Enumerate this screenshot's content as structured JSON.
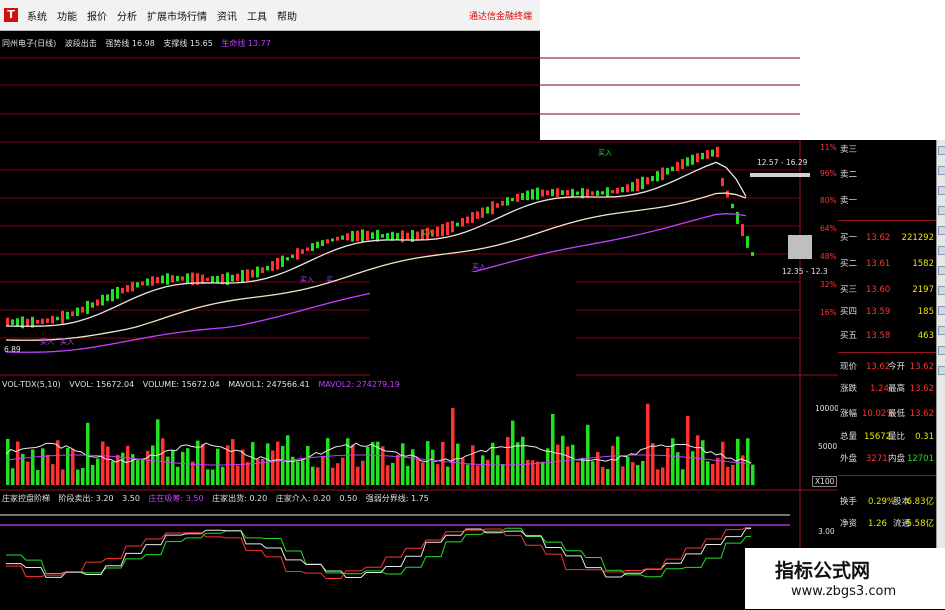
{
  "menu": {
    "app_icon": "T",
    "items": [
      "系统",
      "功能",
      "报价",
      "分析",
      "扩展市场行情",
      "资讯",
      "工具",
      "帮助"
    ],
    "broker_link": "通达信金融终端"
  },
  "main_panel": {
    "indicators": [
      {
        "label": "同州电子(日线)",
        "color": "#e0e0e0"
      },
      {
        "label": "波段出击",
        "color": "#e0e0e0"
      },
      {
        "label": "强势线 16.98",
        "color": "#e0e0e0"
      },
      {
        "label": "支撑线 15.65",
        "color": "#e0e0e0"
      },
      {
        "label": "生命线 13.77",
        "color": "#c040ff"
      }
    ],
    "annotations": [
      "买入",
      "买入",
      "买入",
      "买",
      "买入",
      "买入",
      "买入"
    ],
    "price_tags": [
      "6.89",
      "12.57 - 16.29",
      "12.35 - 12.3"
    ]
  },
  "volume_panel": {
    "legend": [
      {
        "label": "VOL-TDX(5,10)",
        "color": "#e0e0e0"
      },
      {
        "label": "VVOL: 15672.04",
        "color": "#e0e0e0"
      },
      {
        "label": "VOLUME: 15672.04",
        "color": "#e0e0e0"
      },
      {
        "label": "MAVOL1: 247566.41",
        "color": "#e0e0e0"
      },
      {
        "label": "MAVOL2: 274279.19",
        "color": "#c040ff"
      }
    ],
    "axis": [
      "10000",
      "5000",
      "X100"
    ]
  },
  "osc_panel": {
    "legend": [
      {
        "label": "庄家控盘阶梯",
        "color": "#e0e0e0"
      },
      {
        "label": "阶段卖出: 3.20",
        "color": "#e0e0e0"
      },
      {
        "label": "3.50",
        "color": "#e0e0e0"
      },
      {
        "label": "庄在吸筹: 3.50",
        "color": "#c040ff"
      },
      {
        "label": "庄家出货: 0.20",
        "color": "#e0e0e0"
      },
      {
        "label": "庄家介入: 0.20",
        "color": "#e0e0e0"
      },
      {
        "label": "0.50",
        "color": "#e0e0e0"
      },
      {
        "label": "强弱分界线: 1.75",
        "color": "#e0e0e0"
      }
    ],
    "axis": [
      "3.00"
    ]
  },
  "pct_axis": [
    "11%",
    "96%",
    "80%",
    "64%",
    "48%",
    "32%",
    "16%"
  ],
  "order_book": {
    "asks_top": [
      "卖三",
      "卖二",
      "卖一"
    ],
    "bids": [
      {
        "label": "买一",
        "price": "13.62",
        "vol": "221292"
      },
      {
        "label": "买二",
        "price": "13.61",
        "vol": "1582"
      },
      {
        "label": "买三",
        "price": "13.60",
        "vol": "2197"
      },
      {
        "label": "买四",
        "price": "13.59",
        "vol": "185"
      },
      {
        "label": "买五",
        "price": "13.58",
        "vol": "463"
      }
    ],
    "stats": [
      {
        "k1": "现价",
        "v1": "13.62",
        "k2": "今开",
        "v2": "13.62"
      },
      {
        "k1": "涨跌",
        "v1": "1.24",
        "k2": "最高",
        "v2": "13.62"
      },
      {
        "k1": "涨幅",
        "v1": "10.02%",
        "k2": "最低",
        "v2": "13.62"
      },
      {
        "k1": "总量",
        "v1": "15672",
        "k2": "量比",
        "v2": "0.31"
      },
      {
        "k1": "外盘",
        "v1": "3271",
        "k2": "内盘",
        "v2": "12701"
      }
    ],
    "stats2": [
      {
        "k1": "换手",
        "v1": "0.29%",
        "k2": "股本",
        "v2": "6.83亿"
      },
      {
        "k1": "净资",
        "v1": "1.26",
        "k2": "流通",
        "v2": "5.58亿"
      }
    ]
  },
  "watermark": {
    "title": "指标公式网",
    "url": "www.zbgs3.com"
  },
  "colors": {
    "up": "#ff3232",
    "down": "#22e022",
    "purple": "#c040ff",
    "gridline": "#7a0010",
    "white": "#e8e8e8"
  }
}
